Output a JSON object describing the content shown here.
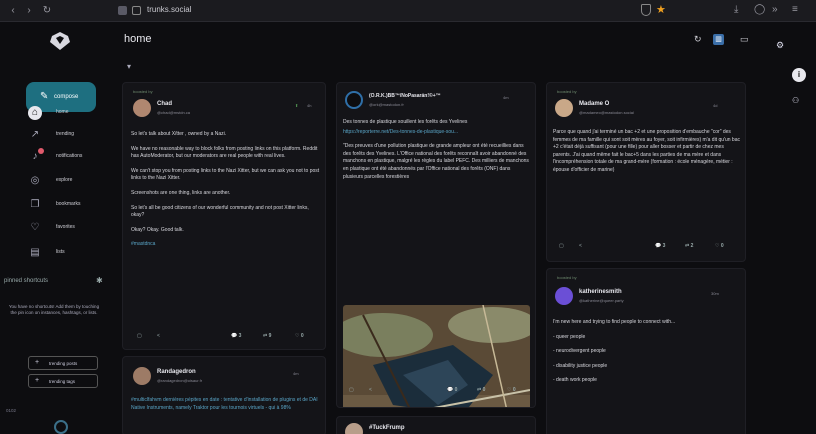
{
  "browser": {
    "url": "trunks.social",
    "back_icon": "chevron-left-icon",
    "forward_icon": "chevron-right-icon",
    "reload_icon": "reload-icon"
  },
  "sidebar": {
    "compose_label": "compose",
    "items": [
      {
        "label": "home",
        "icon": "home-icon"
      },
      {
        "label": "trending",
        "icon": "trending-icon"
      },
      {
        "label": "notifications",
        "icon": "bell-icon"
      },
      {
        "label": "explore",
        "icon": "compass-icon"
      },
      {
        "label": "bookmarks",
        "icon": "bookmark-icon"
      },
      {
        "label": "favorites",
        "icon": "heart-icon"
      },
      {
        "label": "lists",
        "icon": "list-icon"
      }
    ],
    "pinned_title": "pinned shortcuts",
    "pinned_note": "You have no shortcuts! Add them by touching the pin icon on instances, hashtags, or lists.",
    "trending_posts": "trending posts",
    "trending_tags": "trending tags",
    "bottom_status": "0102"
  },
  "header": {
    "title": "home"
  },
  "posts": {
    "chad": {
      "boost": "boosted by",
      "name": "Chad",
      "handle": "@chad@mstdn.ca",
      "time": "4h",
      "paragraphs": [
        "So let's talk about X/tter , owned by a Nazi.",
        "We have no reasonable way to block folks from posting links on this platform. Reddit has AutoModerator, but our moderators are real people with real lives.",
        "We can't stop you from posting links to the Nazi Xitter, but we can ask you not to post links to the Nazi Xitter.",
        "Screenshots are one thing, links are another.",
        "So let's all be good citizens of our wonderful community and not post Xitter links, okay?",
        "Okay? Okay. Good talk.",
        "#mastdnca"
      ],
      "replies": "3",
      "boosts": "9",
      "favs": "0"
    },
    "randagedron": {
      "name": "Randagedron",
      "handle": "@randagedron@oisaur.fr",
      "time": "4m",
      "text": "#multiclfahvm dernières pépites en date : tentative d'installation de plugins et de DAI Native Instruments, namely Traktor pour les tournois virtuels - qui à 98%"
    },
    "forest": {
      "name": "(O.R.K.)BB™/NoPasarán!©+™",
      "handle": "@ork@mastodon.fr",
      "time": "4m",
      "headline": "Des tonnes de plastique souillent les forêts des Yvelines",
      "link": "https://reporterre.net/Des-tonnes-de-plastique-sou...",
      "text": "\"Des preuves d'une pollution plastique de grande ampleur ont été recueillies dans des forêts des Yvelines. L'Office national des forêts reconnaît avoir abandonné des manchons en plastique, malgré les règles du label PEFC. Des milliers de manchons en plastique ont été abandonnés par l'Office national des forêts (ONF) dans plusieurs parcelles forestières",
      "replies": "0",
      "boosts": "0",
      "favs": "0"
    },
    "madame": {
      "boost": "boosted by",
      "name": "Madame O",
      "handle": "@madameo@mastodon.social",
      "time": "4d",
      "text": "Parce que quand j'ai terminé un bac +2 et une proposition d'embauche \"cor\" des femmes de ma famille qui sont soit mères au foyer, soit infirmières) m'a dit qu'un bac +2 c'était déjà suffisant (pour une fille) pour aller bosser et partir de chez mes parents. J'ai quand même fait le bac+5 dans les parties de ma mère et dans l'incompréhension totale de ma grand-mère (formation : école ménagère, métier : épouse d'officier de marine)",
      "replies": "3",
      "boosts": "2",
      "favs": "0"
    },
    "katherine": {
      "boost": "boosted by",
      "name": "katherinesmith",
      "handle": "@katherine@queer.party",
      "time": "30m",
      "intro": "I'm new here and trying to find people to connect with...",
      "items": [
        "- queer people",
        "- neurodivergent people",
        "- disability justice people",
        "- death work people"
      ]
    },
    "tuck": {
      "name": "#TuckFrump"
    }
  },
  "colors": {
    "accent": "#1e6f80",
    "background": "#0d0d10",
    "card": "#141418",
    "link": "#5aa6c8"
  }
}
